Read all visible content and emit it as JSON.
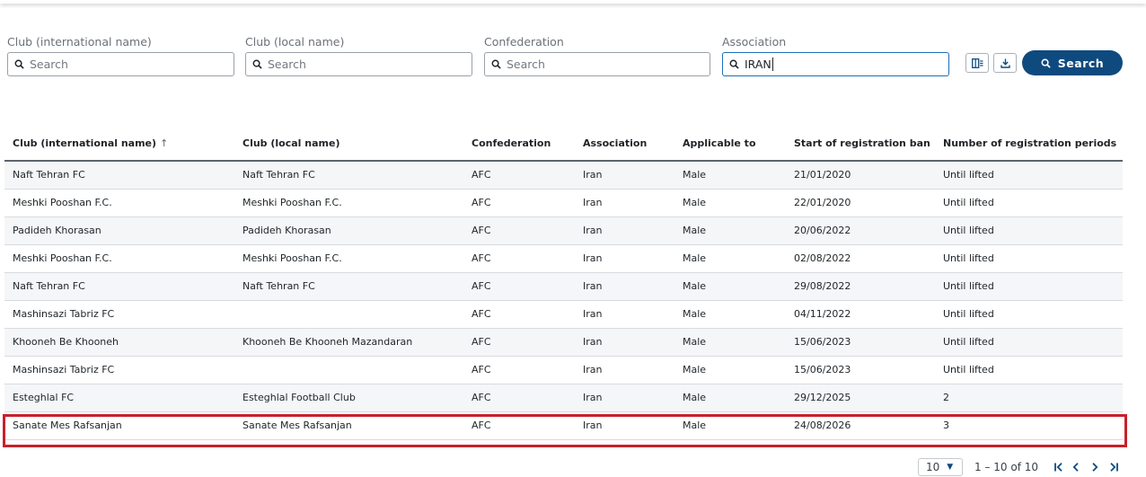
{
  "filters": [
    {
      "label": "Club (international name)",
      "value": "",
      "placeholder": "Search"
    },
    {
      "label": "Club (local name)",
      "value": "",
      "placeholder": "Search"
    },
    {
      "label": "Confederation",
      "value": "",
      "placeholder": "Search"
    },
    {
      "label": "Association",
      "value": "IRAN",
      "placeholder": "Search"
    }
  ],
  "toolbar": {
    "columns_icon": "column-chooser-icon",
    "download_icon": "download-icon",
    "search_label": "Search"
  },
  "table": {
    "columns": [
      "Club (international name)",
      "Club (local name)",
      "Confederation",
      "Association",
      "Applicable to",
      "Start of registration ban",
      "Number of registration periods"
    ],
    "sort_indicator": "↑",
    "rows": [
      [
        "Naft Tehran FC",
        "Naft Tehran FC",
        "AFC",
        "Iran",
        "Male",
        "21/01/2020",
        "Until lifted"
      ],
      [
        "Meshki Pooshan F.C.",
        "Meshki Pooshan F.C.",
        "AFC",
        "Iran",
        "Male",
        "22/01/2020",
        "Until lifted"
      ],
      [
        "Padideh Khorasan",
        "Padideh Khorasan",
        "AFC",
        "Iran",
        "Male",
        "20/06/2022",
        "Until lifted"
      ],
      [
        "Meshki Pooshan F.C.",
        "Meshki Pooshan F.C.",
        "AFC",
        "Iran",
        "Male",
        "02/08/2022",
        "Until lifted"
      ],
      [
        "Naft Tehran FC",
        "Naft Tehran FC",
        "AFC",
        "Iran",
        "Male",
        "29/08/2022",
        "Until lifted"
      ],
      [
        "Mashinsazi Tabriz FC",
        "",
        "AFC",
        "Iran",
        "Male",
        "04/11/2022",
        "Until lifted"
      ],
      [
        "Khooneh Be Khooneh",
        "Khooneh Be Khooneh Mazandaran",
        "AFC",
        "Iran",
        "Male",
        "15/06/2023",
        "Until lifted"
      ],
      [
        "Mashinsazi Tabriz FC",
        "",
        "AFC",
        "Iran",
        "Male",
        "15/06/2023",
        "Until lifted"
      ],
      [
        "Esteghlal FC",
        "Esteghlal Football Club",
        "AFC",
        "Iran",
        "Male",
        "29/12/2025",
        "2"
      ],
      [
        "Sanate Mes Rafsanjan",
        "Sanate Mes Rafsanjan",
        "AFC",
        "Iran",
        "Male",
        "24/08/2026",
        "3"
      ]
    ],
    "highlighted_row_index": 9
  },
  "pagination": {
    "page_size": "10",
    "range_text": "1 – 10 of 10"
  },
  "colors": {
    "primary": "#0f4a7f",
    "highlight": "#c8202b",
    "stripe": "#f5f6f8"
  }
}
